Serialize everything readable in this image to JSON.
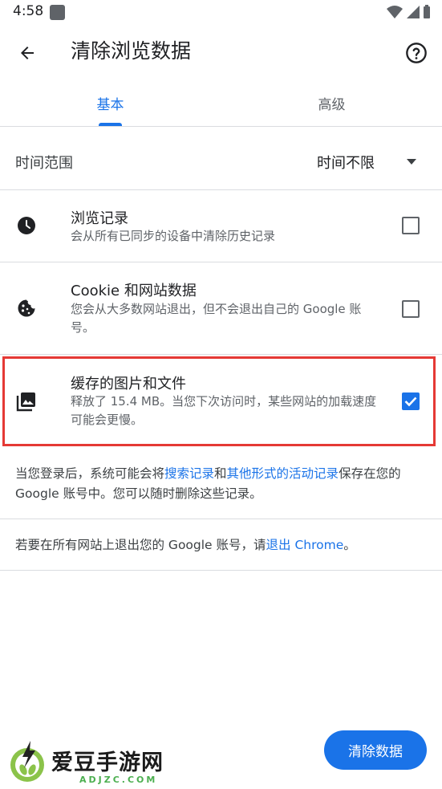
{
  "status_bar": {
    "time": "4:58"
  },
  "header": {
    "title": "清除浏览数据"
  },
  "tabs": [
    {
      "label": "基本",
      "selected": true
    },
    {
      "label": "高级",
      "selected": false
    }
  ],
  "time_range": {
    "label": "时间范围",
    "value": "时间不限"
  },
  "options": [
    {
      "title": "浏览记录",
      "description": "会从所有已同步的设备中清除历史记录",
      "checked": false,
      "icon": "clock-icon"
    },
    {
      "title": "Cookie 和网站数据",
      "description": "您会从大多数网站退出，但不会退出自己的 Google 账号。",
      "checked": false,
      "icon": "cookie-icon"
    },
    {
      "title": "缓存的图片和文件",
      "description": "释放了 15.4 MB。当您下次访问时，某些网站的加载速度可能会更慢。",
      "checked": true,
      "icon": "image-icon"
    }
  ],
  "notice1": {
    "text_a": "当您登录后，系统可能会将",
    "link_a": "搜索记录",
    "text_b": "和",
    "link_b": "其他形式的活动记录",
    "text_c": "保存在您的 Google 账号中。您可以随时删除这些记录。"
  },
  "notice2": {
    "text_a": "若要在所有网站上退出您的 Google 账号，请",
    "link": "退出 Chrome",
    "text_b": "。"
  },
  "clear_button": {
    "label": "清除数据"
  },
  "watermark": {
    "name": "爱豆手游网",
    "url": "ADJZC.COM"
  },
  "colors": {
    "accent": "#1a73e8",
    "highlight": "#e53935",
    "divider": "#dadce0"
  }
}
